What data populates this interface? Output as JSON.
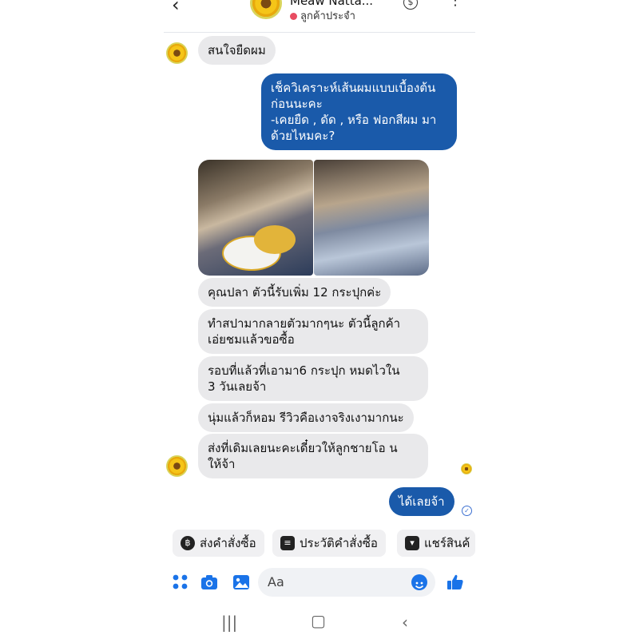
{
  "header": {
    "back": "‹",
    "name": "Meaw Natta...",
    "status": "ลูกค้าประจำ",
    "more": "⋮"
  },
  "messages": {
    "m1": "สนใจยืดผม",
    "m2_line1": "เช็ควิเคราะห์เส้นผมแบบเบื้องต้น",
    "m2_line2": "ก่อนนะคะ",
    "m2_line3": "-เคยยืด , ดัด , หรือ ฟอกสีผม มา",
    "m2_line4": "ด้วยไหมคะ?",
    "m3": "คุณปลา ตัวนี้รับเพิ่ม 12 กระปุกค่ะ",
    "m4_line1": "ทำสปามากลายตัวมากๆนะ ตัวนี้ลูกค้า",
    "m4_line2": "เอ่ยชมแล้วขอซื้อ",
    "m5_line1": "รอบที่แล้วที่เอามา6 กระปุก หมดไวใน",
    "m5_line2": "3  วันเลยจ้า",
    "m6": "นุ่มแล้วก็หอม รีวิวคือเงาจริงเงามากนะ",
    "m7_line1": "ส่งที่เดิมเลยนะคะเดี๋ยวให้ลูกชายโอ น",
    "m7_line2": "ให้จ้า",
    "m8": "ได้เลยจ้า"
  },
  "chips": {
    "order": "ส่งคำสั่งซื้อ",
    "history": "ประวัติคำสั่งซื้อ",
    "share": "แชร์สินค้"
  },
  "composer": {
    "placeholder": "Aa"
  },
  "colors": {
    "outgoing_bubble": "#1a5aaa",
    "incoming_bubble": "#e9e9eb",
    "accent": "#1a73e8"
  }
}
